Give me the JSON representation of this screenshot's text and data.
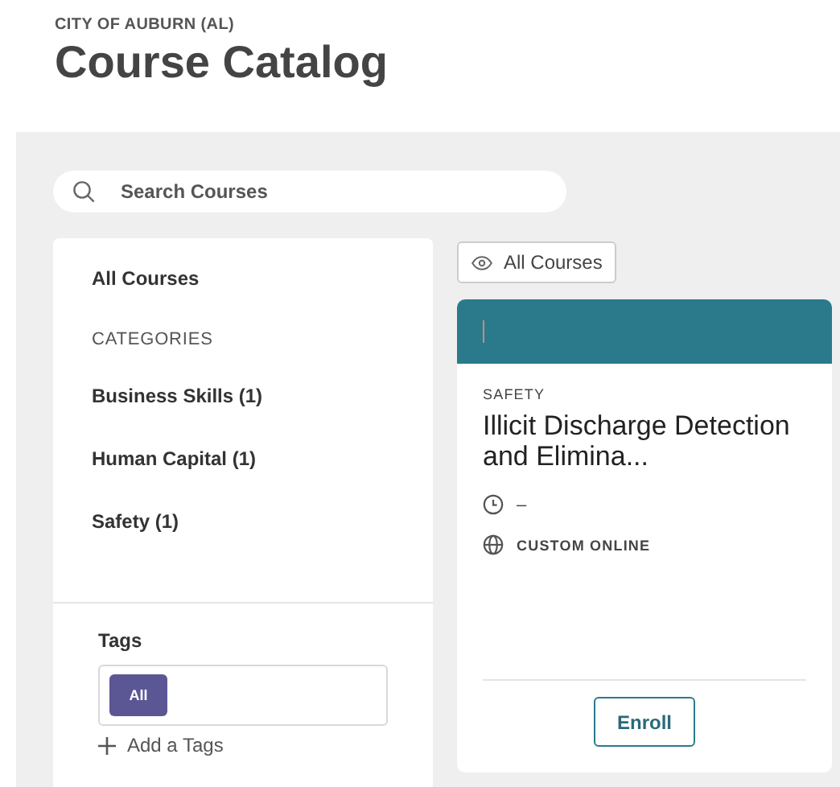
{
  "header": {
    "organization": "CITY OF AUBURN (AL)",
    "title": "Course Catalog"
  },
  "search": {
    "placeholder": "Search Courses"
  },
  "sidebar": {
    "all_link": "All Courses",
    "categories_heading": "CATEGORIES",
    "categories": [
      {
        "label": "Business Skills (1)"
      },
      {
        "label": "Human Capital (1)"
      },
      {
        "label": "Safety (1)"
      }
    ],
    "tags": {
      "heading": "Tags",
      "chips": [
        {
          "label": "All"
        }
      ],
      "add_label": "Add a Tags"
    }
  },
  "view_filter": {
    "label": "All Courses"
  },
  "courses": [
    {
      "category": "SAFETY",
      "title": "Illicit Discharge Detection and Elimina...",
      "duration": "–",
      "delivery": "CUSTOM ONLINE",
      "action": "Enroll"
    }
  ]
}
